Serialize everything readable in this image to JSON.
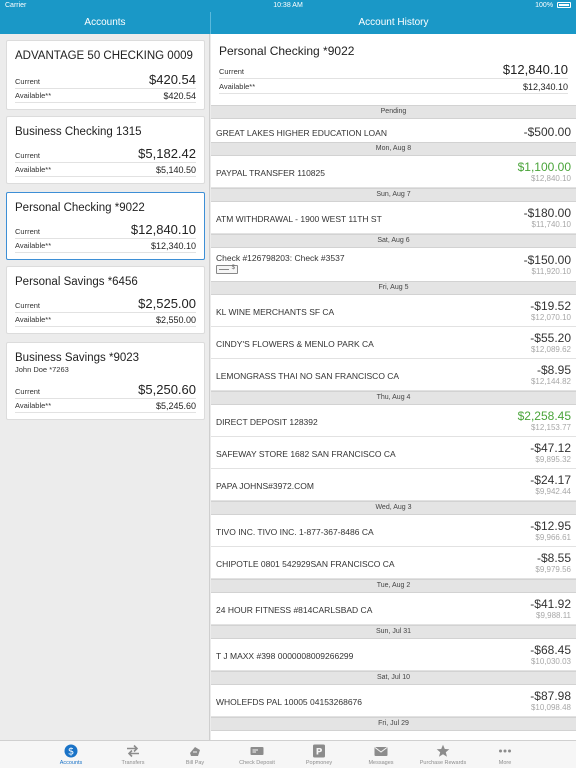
{
  "status": {
    "carrier": "Carrier",
    "time": "10:38 AM",
    "battery": "100%"
  },
  "left": {
    "title": "Accounts"
  },
  "right": {
    "title": "Account History"
  },
  "accounts": [
    {
      "name": "ADVANTAGE 50 CHECKING 0009",
      "sub": "",
      "current_label": "Current",
      "current": "$420.54",
      "available_label": "Available**",
      "available": "$420.54"
    },
    {
      "name": "Business Checking 1315",
      "sub": "",
      "current_label": "Current",
      "current": "$5,182.42",
      "available_label": "Available**",
      "available": "$5,140.50"
    },
    {
      "name": "Personal Checking *9022",
      "sub": "",
      "current_label": "Current",
      "current": "$12,840.10",
      "available_label": "Available**",
      "available": "$12,340.10"
    },
    {
      "name": "Personal Savings *6456",
      "sub": "",
      "current_label": "Current",
      "current": "$2,525.00",
      "available_label": "Available**",
      "available": "$2,550.00"
    },
    {
      "name": "Business Savings *9023",
      "sub": "John Doe *7263",
      "current_label": "Current",
      "current": "$5,250.60",
      "available_label": "Available**",
      "available": "$5,245.60"
    }
  ],
  "history": {
    "name": "Personal Checking *9022",
    "current_label": "Current",
    "current": "$12,840.10",
    "available_label": "Available**",
    "available": "$12,340.10",
    "sections": [
      {
        "title": "Pending"
      },
      {
        "title": "Mon, Aug 8"
      },
      {
        "title": "Sun, Aug 7"
      },
      {
        "title": "Sat, Aug 6"
      },
      {
        "title": "Fri, Aug 5"
      },
      {
        "title": "Thu, Aug 4"
      },
      {
        "title": "Wed, Aug 3"
      },
      {
        "title": "Tue, Aug 2"
      },
      {
        "title": "Sun, Jul 31"
      },
      {
        "title": "Sat, Jul 10"
      },
      {
        "title": "Fri, Jul 29"
      }
    ],
    "transactions": [
      {
        "desc": "GREAT LAKES HIGHER EDUCATION LOAN",
        "amount": "-$500.00",
        "balance": ""
      },
      {
        "desc": "PAYPAL TRANSFER 110825",
        "amount": "$1,100.00",
        "balance": "$12,840.10"
      },
      {
        "desc": "ATM WITHDRAWAL - 1900 WEST 11TH ST",
        "amount": "-$180.00",
        "balance": "$11,740.10"
      },
      {
        "desc": "Check #126798203: Check #3537",
        "amount": "-$150.00",
        "balance": "$11,920.10"
      },
      {
        "desc": "KL WINE MERCHANTS SF CA",
        "amount": "-$19.52",
        "balance": "$12,070.10"
      },
      {
        "desc": "CINDY'S FLOWERS & MENLO PARK CA",
        "amount": "-$55.20",
        "balance": "$12,089.62"
      },
      {
        "desc": "LEMONGRASS THAI NO SAN FRANCISCO CA",
        "amount": "-$8.95",
        "balance": "$12,144.82"
      },
      {
        "desc": "DIRECT DEPOSIT 128392",
        "amount": "$2,258.45",
        "balance": "$12,153.77"
      },
      {
        "desc": "SAFEWAY STORE 1682 SAN FRANCISCO CA",
        "amount": "-$47.12",
        "balance": "$9,895.32"
      },
      {
        "desc": "PAPA JOHNS#3972.COM",
        "amount": "-$24.17",
        "balance": "$9,942.44"
      },
      {
        "desc": "TIVO INC. TIVO INC. 1-877-367-8486 CA",
        "amount": "-$12.95",
        "balance": "$9,966.61"
      },
      {
        "desc": "CHIPOTLE 0801 542929SAN FRANCISCO CA",
        "amount": "-$8.55",
        "balance": "$9,979.56"
      },
      {
        "desc": "24 HOUR FITNESS #814CARLSBAD CA",
        "amount": "-$41.92",
        "balance": "$9,988.11"
      },
      {
        "desc": "T J MAXX #398 0000008009266299",
        "amount": "-$68.45",
        "balance": "$10,030.03"
      },
      {
        "desc": "WHOLEFDS PAL 10005 04153268676",
        "amount": "-$87.98",
        "balance": "$10,098.48"
      }
    ]
  },
  "tabs": [
    {
      "label": "Accounts",
      "icon": "dollar-circle-icon"
    },
    {
      "label": "Transfers",
      "icon": "transfer-arrows-icon"
    },
    {
      "label": "Bill Pay",
      "icon": "bill-pay-icon"
    },
    {
      "label": "Check Deposit",
      "icon": "check-deposit-icon"
    },
    {
      "label": "Popmoney",
      "icon": "popmoney-icon"
    },
    {
      "label": "Messages",
      "icon": "envelope-icon"
    },
    {
      "label": "Purchase Rewards",
      "icon": "star-icon"
    },
    {
      "label": "More",
      "icon": "more-dots-icon"
    }
  ],
  "colors": {
    "brand": "#1a98c7",
    "positive": "#4aa43a",
    "selected_border": "#3d8fd6",
    "active_tab": "#1a73c7"
  }
}
